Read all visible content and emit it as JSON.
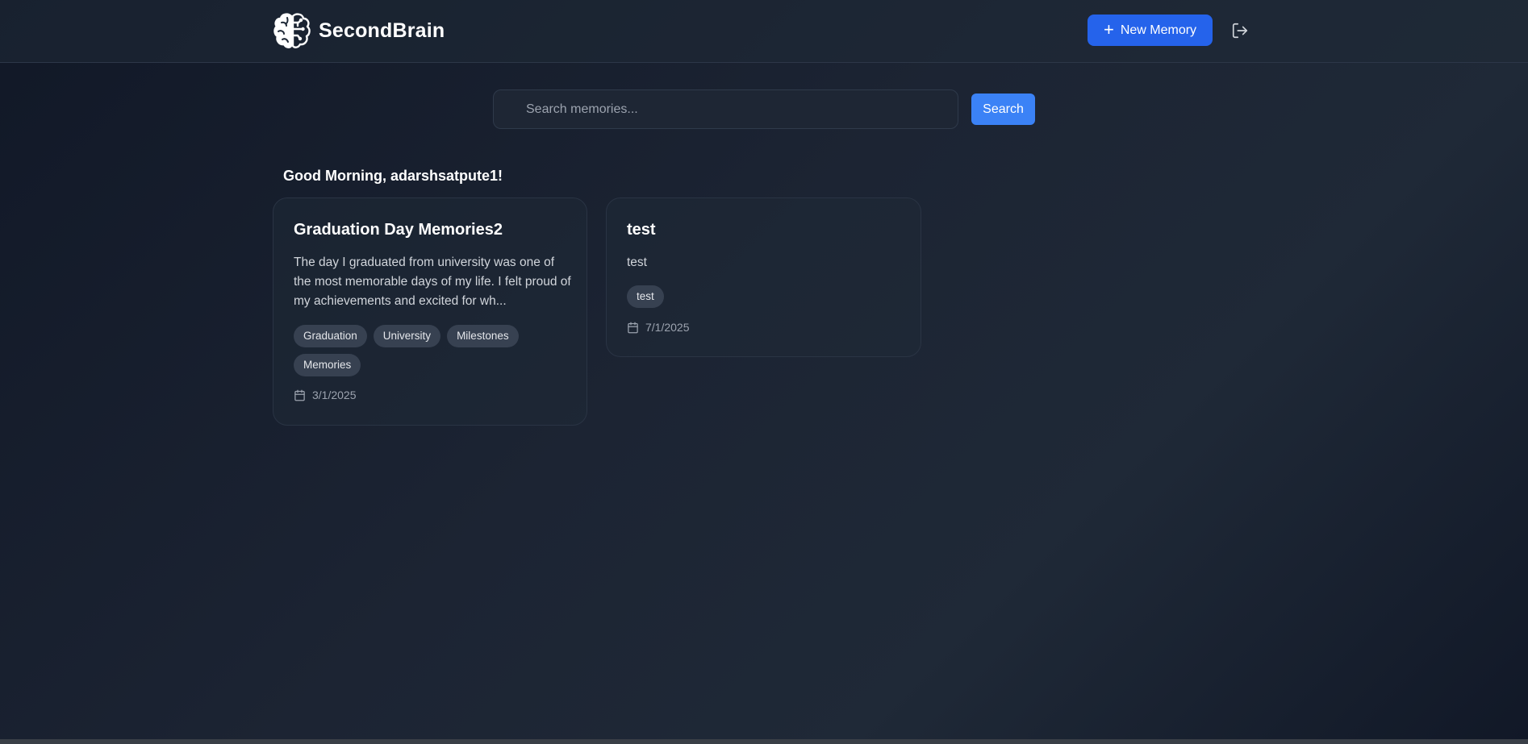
{
  "header": {
    "brand_name": "SecondBrain",
    "brand_icon": "brain-icon",
    "new_memory_label": "New Memory",
    "new_memory_icon": "plus-icon",
    "logout_icon": "logout-icon",
    "accent_color": "#2563eb"
  },
  "search": {
    "placeholder": "Search memories...",
    "value": "",
    "button_label": "Search",
    "button_color": "#3b82f6"
  },
  "greeting": "Good Morning, adarshsatpute1!",
  "memories": [
    {
      "title": "Graduation Day Memories2",
      "body": "The day I graduated from university was one of the most memorable days of my life. I felt proud of my achievements and excited for wh...",
      "tags": [
        "Graduation",
        "University",
        "Milestones",
        "Memories"
      ],
      "date": "3/1/2025",
      "date_icon": "calendar-icon"
    },
    {
      "title": "test",
      "body": "test",
      "tags": [
        "test"
      ],
      "date": "7/1/2025",
      "date_icon": "calendar-icon"
    }
  ]
}
